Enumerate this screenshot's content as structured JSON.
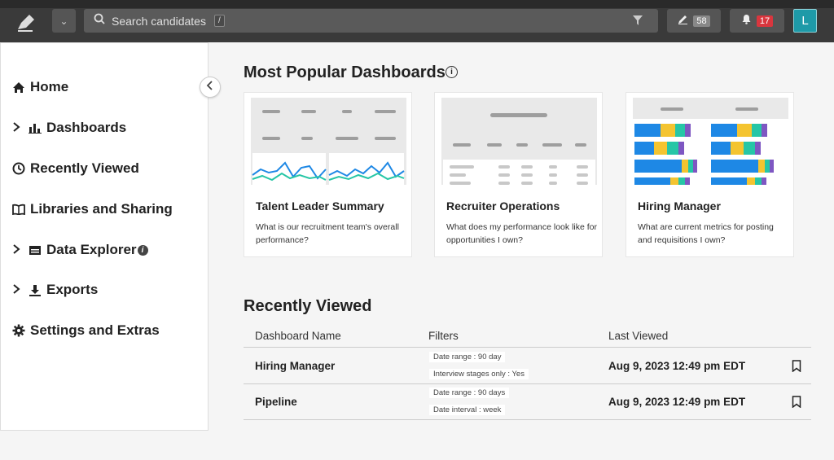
{
  "topbar": {
    "search_placeholder": "Search candidates",
    "search_shortcut": "/",
    "edit_count": "58",
    "notification_count": "17",
    "avatar_initial": "L"
  },
  "sidebar": {
    "items": [
      {
        "label": "Home",
        "icon": "home-icon",
        "expandable": false
      },
      {
        "label": "Dashboards",
        "icon": "bar-chart-icon",
        "expandable": true
      },
      {
        "label": "Recently Viewed",
        "icon": "clock-icon",
        "expandable": false
      },
      {
        "label": "Libraries and Sharing",
        "icon": "book-icon",
        "expandable": false
      },
      {
        "label": "Data Explorer",
        "icon": "table-icon",
        "expandable": true
      },
      {
        "label": "Exports",
        "icon": "download-icon",
        "expandable": true
      },
      {
        "label": "Settings and Extras",
        "icon": "gear-icon",
        "expandable": false
      }
    ]
  },
  "popular": {
    "title": "Most Popular Dashboards",
    "cards": [
      {
        "title": "Talent Leader Summary",
        "description": "What is our recruitment team's overall performance?"
      },
      {
        "title": "Recruiter Operations",
        "description": "What does my performance look like for opportunities I own?"
      },
      {
        "title": "Hiring Manager",
        "description": "What are current metrics for posting and requisitions I own?"
      }
    ]
  },
  "recent": {
    "title": "Recently Viewed",
    "columns": [
      "Dashboard Name",
      "Filters",
      "Last Viewed"
    ],
    "rows": [
      {
        "name": "Hiring Manager",
        "filters": [
          "Date range : 90 day",
          "Interview stages only : Yes"
        ],
        "last_viewed": "Aug 9, 2023 12:49 pm EDT"
      },
      {
        "name": "Pipeline",
        "filters": [
          "Date range : 90 days",
          "Date interval : week"
        ],
        "last_viewed": "Aug 9, 2023 12:49 pm EDT"
      }
    ]
  },
  "colors": {
    "blue": "#1e88e5",
    "yellow": "#f4c430",
    "teal": "#26c6a6",
    "purple": "#7e57c2",
    "alert_red": "#d9363e",
    "avatar_teal": "#1e9aa8"
  }
}
